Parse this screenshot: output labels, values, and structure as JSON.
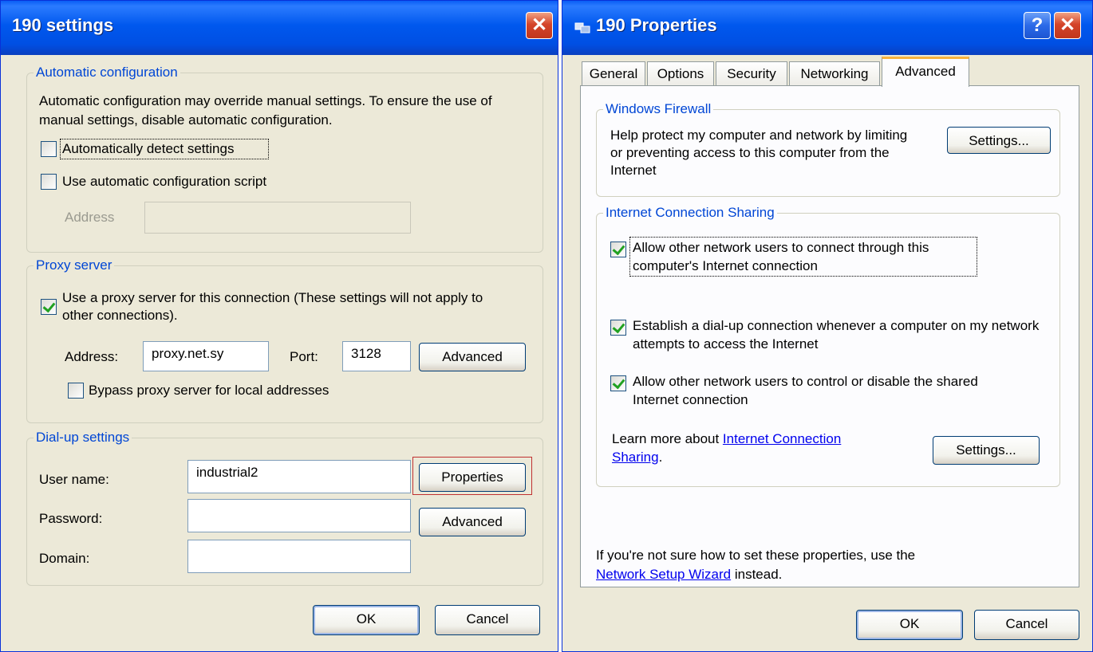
{
  "left_window": {
    "title": "190 settings",
    "close_glyph": "✕",
    "auto_config": {
      "legend": "Automatic configuration",
      "description": "Automatic configuration may override manual settings.  To ensure the use of manual settings, disable automatic configuration.",
      "auto_detect_label": "Automatically detect settings",
      "auto_detect_checked": false,
      "script_label": "Use automatic configuration script",
      "script_checked": false,
      "address_label": "Address",
      "address_value": ""
    },
    "proxy": {
      "legend": "Proxy server",
      "use_proxy_label": "Use a proxy server for this connection (These settings will not apply to other connections).",
      "use_proxy_checked": true,
      "address_label": "Address:",
      "address_value": "proxy.net.sy",
      "port_label": "Port:",
      "port_value": "3128",
      "advanced_label": "Advanced",
      "bypass_label": "Bypass proxy server for local addresses",
      "bypass_checked": false
    },
    "dialup": {
      "legend": "Dial-up settings",
      "username_label": "User name:",
      "username_value": "industrial2",
      "password_label": "Password:",
      "password_value": "",
      "domain_label": "Domain:",
      "domain_value": "",
      "properties_label": "Properties",
      "advanced_label": "Advanced"
    },
    "ok_label": "OK",
    "cancel_label": "Cancel"
  },
  "right_window": {
    "title": "190 Properties",
    "help_glyph": "?",
    "close_glyph": "✕",
    "tabs": [
      "General",
      "Options",
      "Security",
      "Networking",
      "Advanced"
    ],
    "active_tab": "Advanced",
    "firewall": {
      "legend": "Windows Firewall",
      "description": "Help protect my computer and network by limiting or preventing access to this computer from the Internet",
      "settings_label": "Settings..."
    },
    "ics": {
      "legend": "Internet Connection Sharing",
      "allow_connect_label": "Allow other network users to connect through this computer's Internet connection",
      "allow_connect_checked": true,
      "dialup_label": "Establish a dial-up connection whenever a computer on my network attempts to access the Internet",
      "dialup_checked": true,
      "allow_control_label": "Allow other network users to control or disable the shared Internet connection",
      "allow_control_checked": true,
      "learn_prefix": "Learn more about ",
      "learn_link": "Internet Connection Sharing",
      "learn_suffix": ".",
      "settings_label": "Settings..."
    },
    "footer_prefix": "If you're not sure how to set these properties, use the ",
    "footer_link": "Network Setup Wizard",
    "footer_suffix": " instead.",
    "ok_label": "OK",
    "cancel_label": "Cancel"
  }
}
